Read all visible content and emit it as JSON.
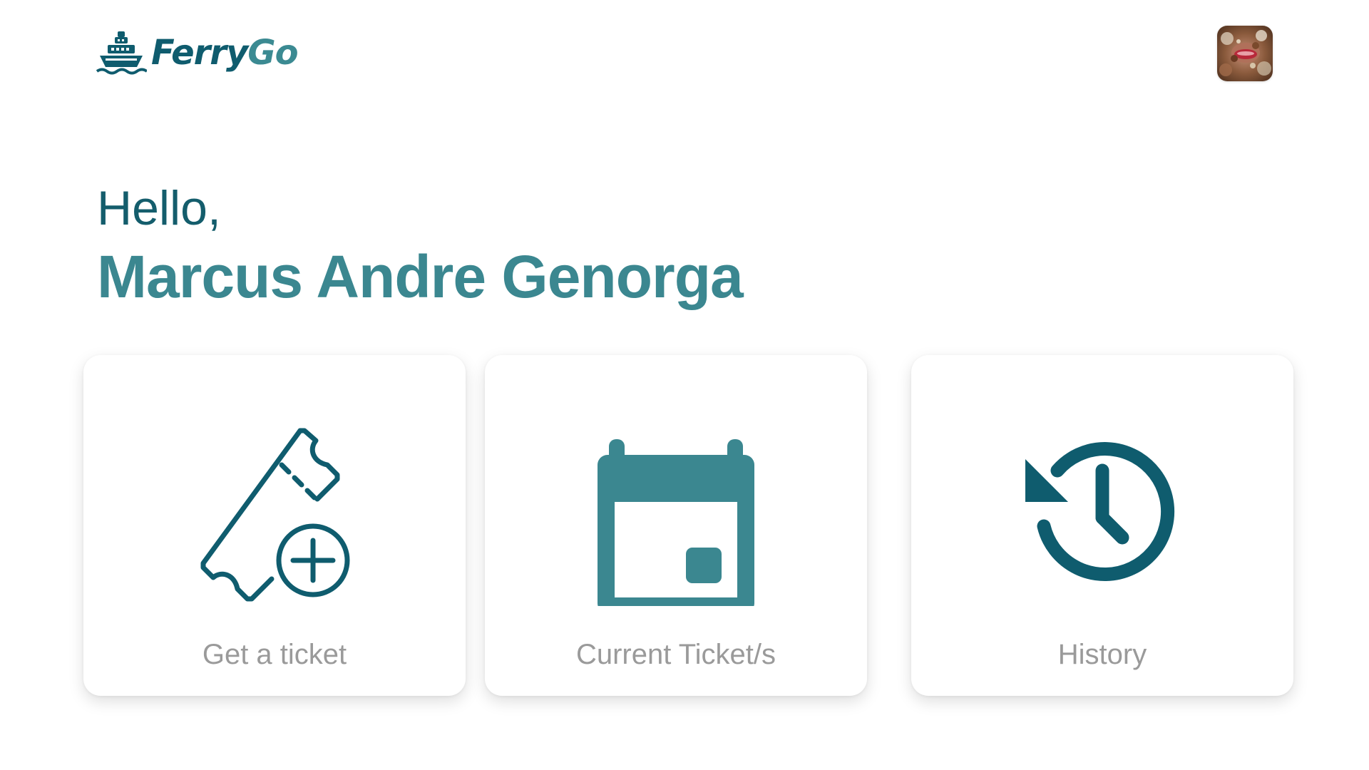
{
  "brand": {
    "name_part1": "Ferry",
    "name_part2": "Go",
    "logo_icon": "ship-icon",
    "primary_color": "#0f5c6e",
    "accent_color": "#3b8a92"
  },
  "header": {
    "avatar_icon": "user-avatar"
  },
  "greeting": {
    "hello": "Hello,",
    "user_name": "Marcus Andre Genorga"
  },
  "cards": [
    {
      "label": "Get a ticket",
      "icon": "ticket-add-icon"
    },
    {
      "label": "Current Ticket/s",
      "icon": "calendar-icon"
    },
    {
      "label": "History",
      "icon": "history-icon"
    }
  ]
}
